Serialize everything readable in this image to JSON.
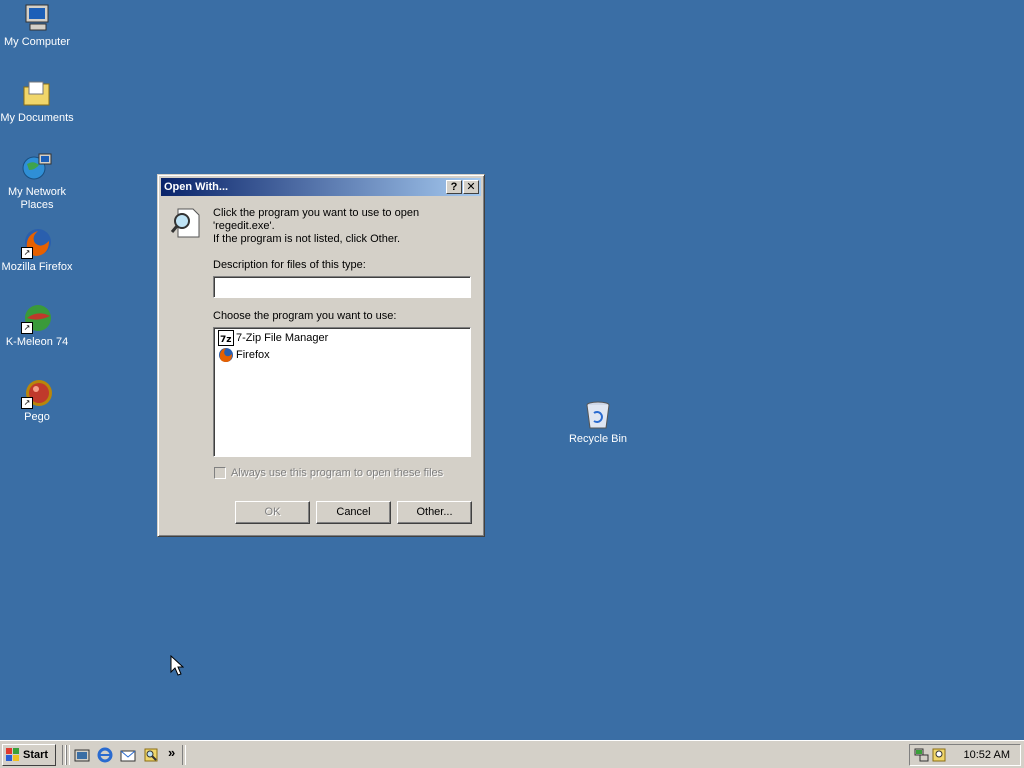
{
  "desktop": {
    "icons": [
      {
        "label": "My Computer"
      },
      {
        "label": "My Documents"
      },
      {
        "label": "My Network Places"
      },
      {
        "label": "Mozilla Firefox"
      },
      {
        "label": "K-Meleon 74"
      },
      {
        "label": "Pego"
      },
      {
        "label": "Recycle Bin"
      }
    ]
  },
  "dialog": {
    "title": "Open With...",
    "help_button": "?",
    "close_button": "✕",
    "intro_line1": "Click the program you want to use to open",
    "intro_line2": "'regedit.exe'.",
    "intro_line3": "If the program is not listed, click Other.",
    "description_label": "Description for files of this type:",
    "description_value": "",
    "choose_label": "Choose the program you want to use:",
    "programs": [
      {
        "label": "7-Zip File Manager"
      },
      {
        "label": "Firefox"
      }
    ],
    "always_use_label": "Always use this program to open these files",
    "always_use_checked": false,
    "ok_label": "OK",
    "cancel_label": "Cancel",
    "other_label": "Other..."
  },
  "taskbar": {
    "start_label": "Start",
    "quicklaunch_more": "»",
    "clock": "10:52 AM"
  },
  "colors": {
    "desktop": "#3a6ea5",
    "title_start": "#0a246a",
    "title_end": "#a6caf0",
    "face": "#d4d0c8"
  }
}
